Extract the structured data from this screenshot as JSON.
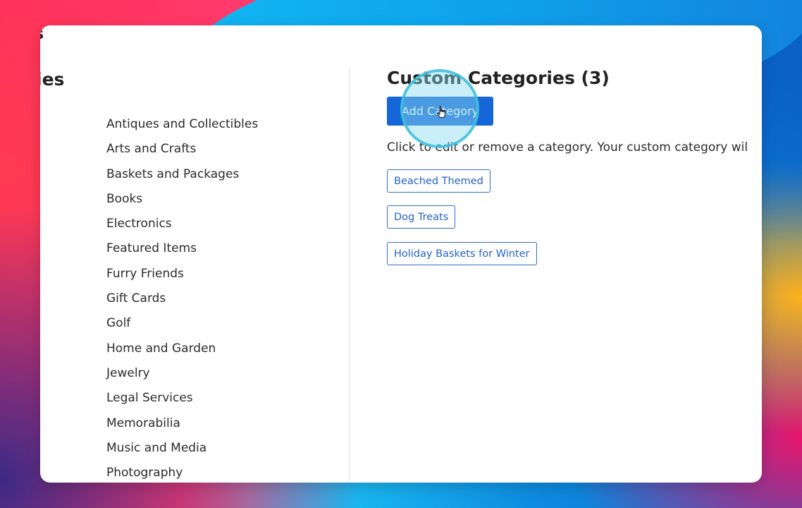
{
  "window": {
    "top_heading": "s",
    "left_heading": "ies"
  },
  "standard_categories": [
    "Antiques and Collectibles",
    "Arts and Crafts",
    "Baskets and Packages",
    "Books",
    "Electronics",
    "Featured Items",
    "Furry Friends",
    "Gift Cards",
    "Golf",
    "Home and Garden",
    "Jewelry",
    "Legal Services",
    "Memorabilia",
    "Music and Media",
    "Photography"
  ],
  "custom": {
    "heading": "Custom Categories (3)",
    "add_button_label": "Add Category",
    "help_text": "Click to edit or remove a category. Your custom category wil",
    "tags": [
      "Beached Themed",
      "Dog Treats",
      "Holiday Baskets for Winter"
    ]
  },
  "colors": {
    "accent": "#1566d6",
    "tag_border": "#2f6fc9",
    "click_ring": "#3cbedc"
  },
  "icons": {
    "cursor": "hand-pointer-icon"
  }
}
